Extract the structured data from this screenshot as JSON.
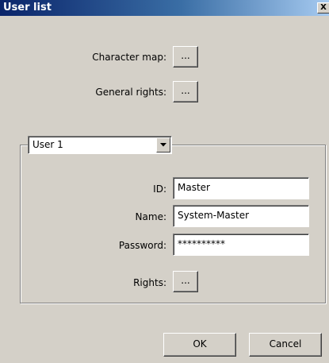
{
  "window": {
    "title": "User list",
    "close_glyph": "X"
  },
  "top": {
    "character_map_label": "Character map:",
    "general_rights_label": "General rights:",
    "ellipsis": "..."
  },
  "user_group": {
    "selected_user": "User 1",
    "id_label": "ID:",
    "id_value": "Master",
    "name_label": "Name:",
    "name_value": "System-Master",
    "password_label": "Password:",
    "password_value": "**********",
    "rights_label": "Rights:",
    "ellipsis": "..."
  },
  "footer": {
    "ok_label": "OK",
    "cancel_label": "Cancel"
  },
  "icons": [
    "close-icon",
    "dropdown-arrow-icon"
  ]
}
